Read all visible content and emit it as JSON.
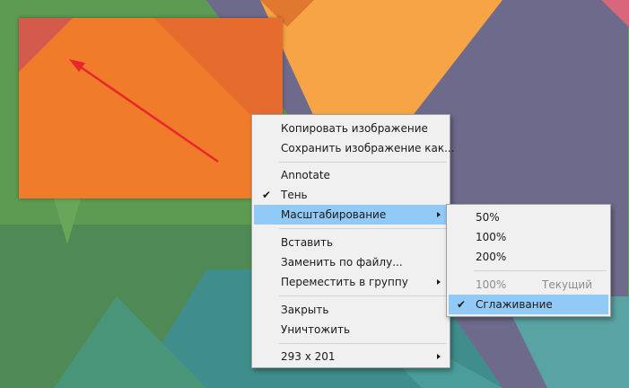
{
  "main_menu": {
    "items": [
      {
        "label": "Копировать изображение"
      },
      {
        "label": "Сохранить изображение как..."
      },
      {
        "label": "Annotate"
      },
      {
        "label": "Тень",
        "checked": true
      },
      {
        "label": "Масштабирование",
        "submenu": true,
        "highlighted": true
      },
      {
        "label": "Вставить"
      },
      {
        "label": "Заменить по файлу..."
      },
      {
        "label": "Переместить в группу",
        "submenu": true
      },
      {
        "label": "Закрыть"
      },
      {
        "label": "Уничтожить"
      },
      {
        "label": "293 x 201",
        "submenu": true
      }
    ]
  },
  "zoom_menu": {
    "items": [
      {
        "label": "50%"
      },
      {
        "label": "100%"
      },
      {
        "label": "200%"
      },
      {
        "label": "100%",
        "hint": "Текущий",
        "disabled": true
      },
      {
        "label": "Сглаживание",
        "checked": true,
        "highlighted": true
      }
    ]
  },
  "colors": {
    "highlight": "#91c9f7",
    "menu_bg": "#f0f0f0",
    "annotation_arrow": "#e8262b"
  },
  "icons": {
    "check": "checkmark-icon",
    "submenu": "chevron-right-icon",
    "annotation": "arrow-annotation"
  }
}
